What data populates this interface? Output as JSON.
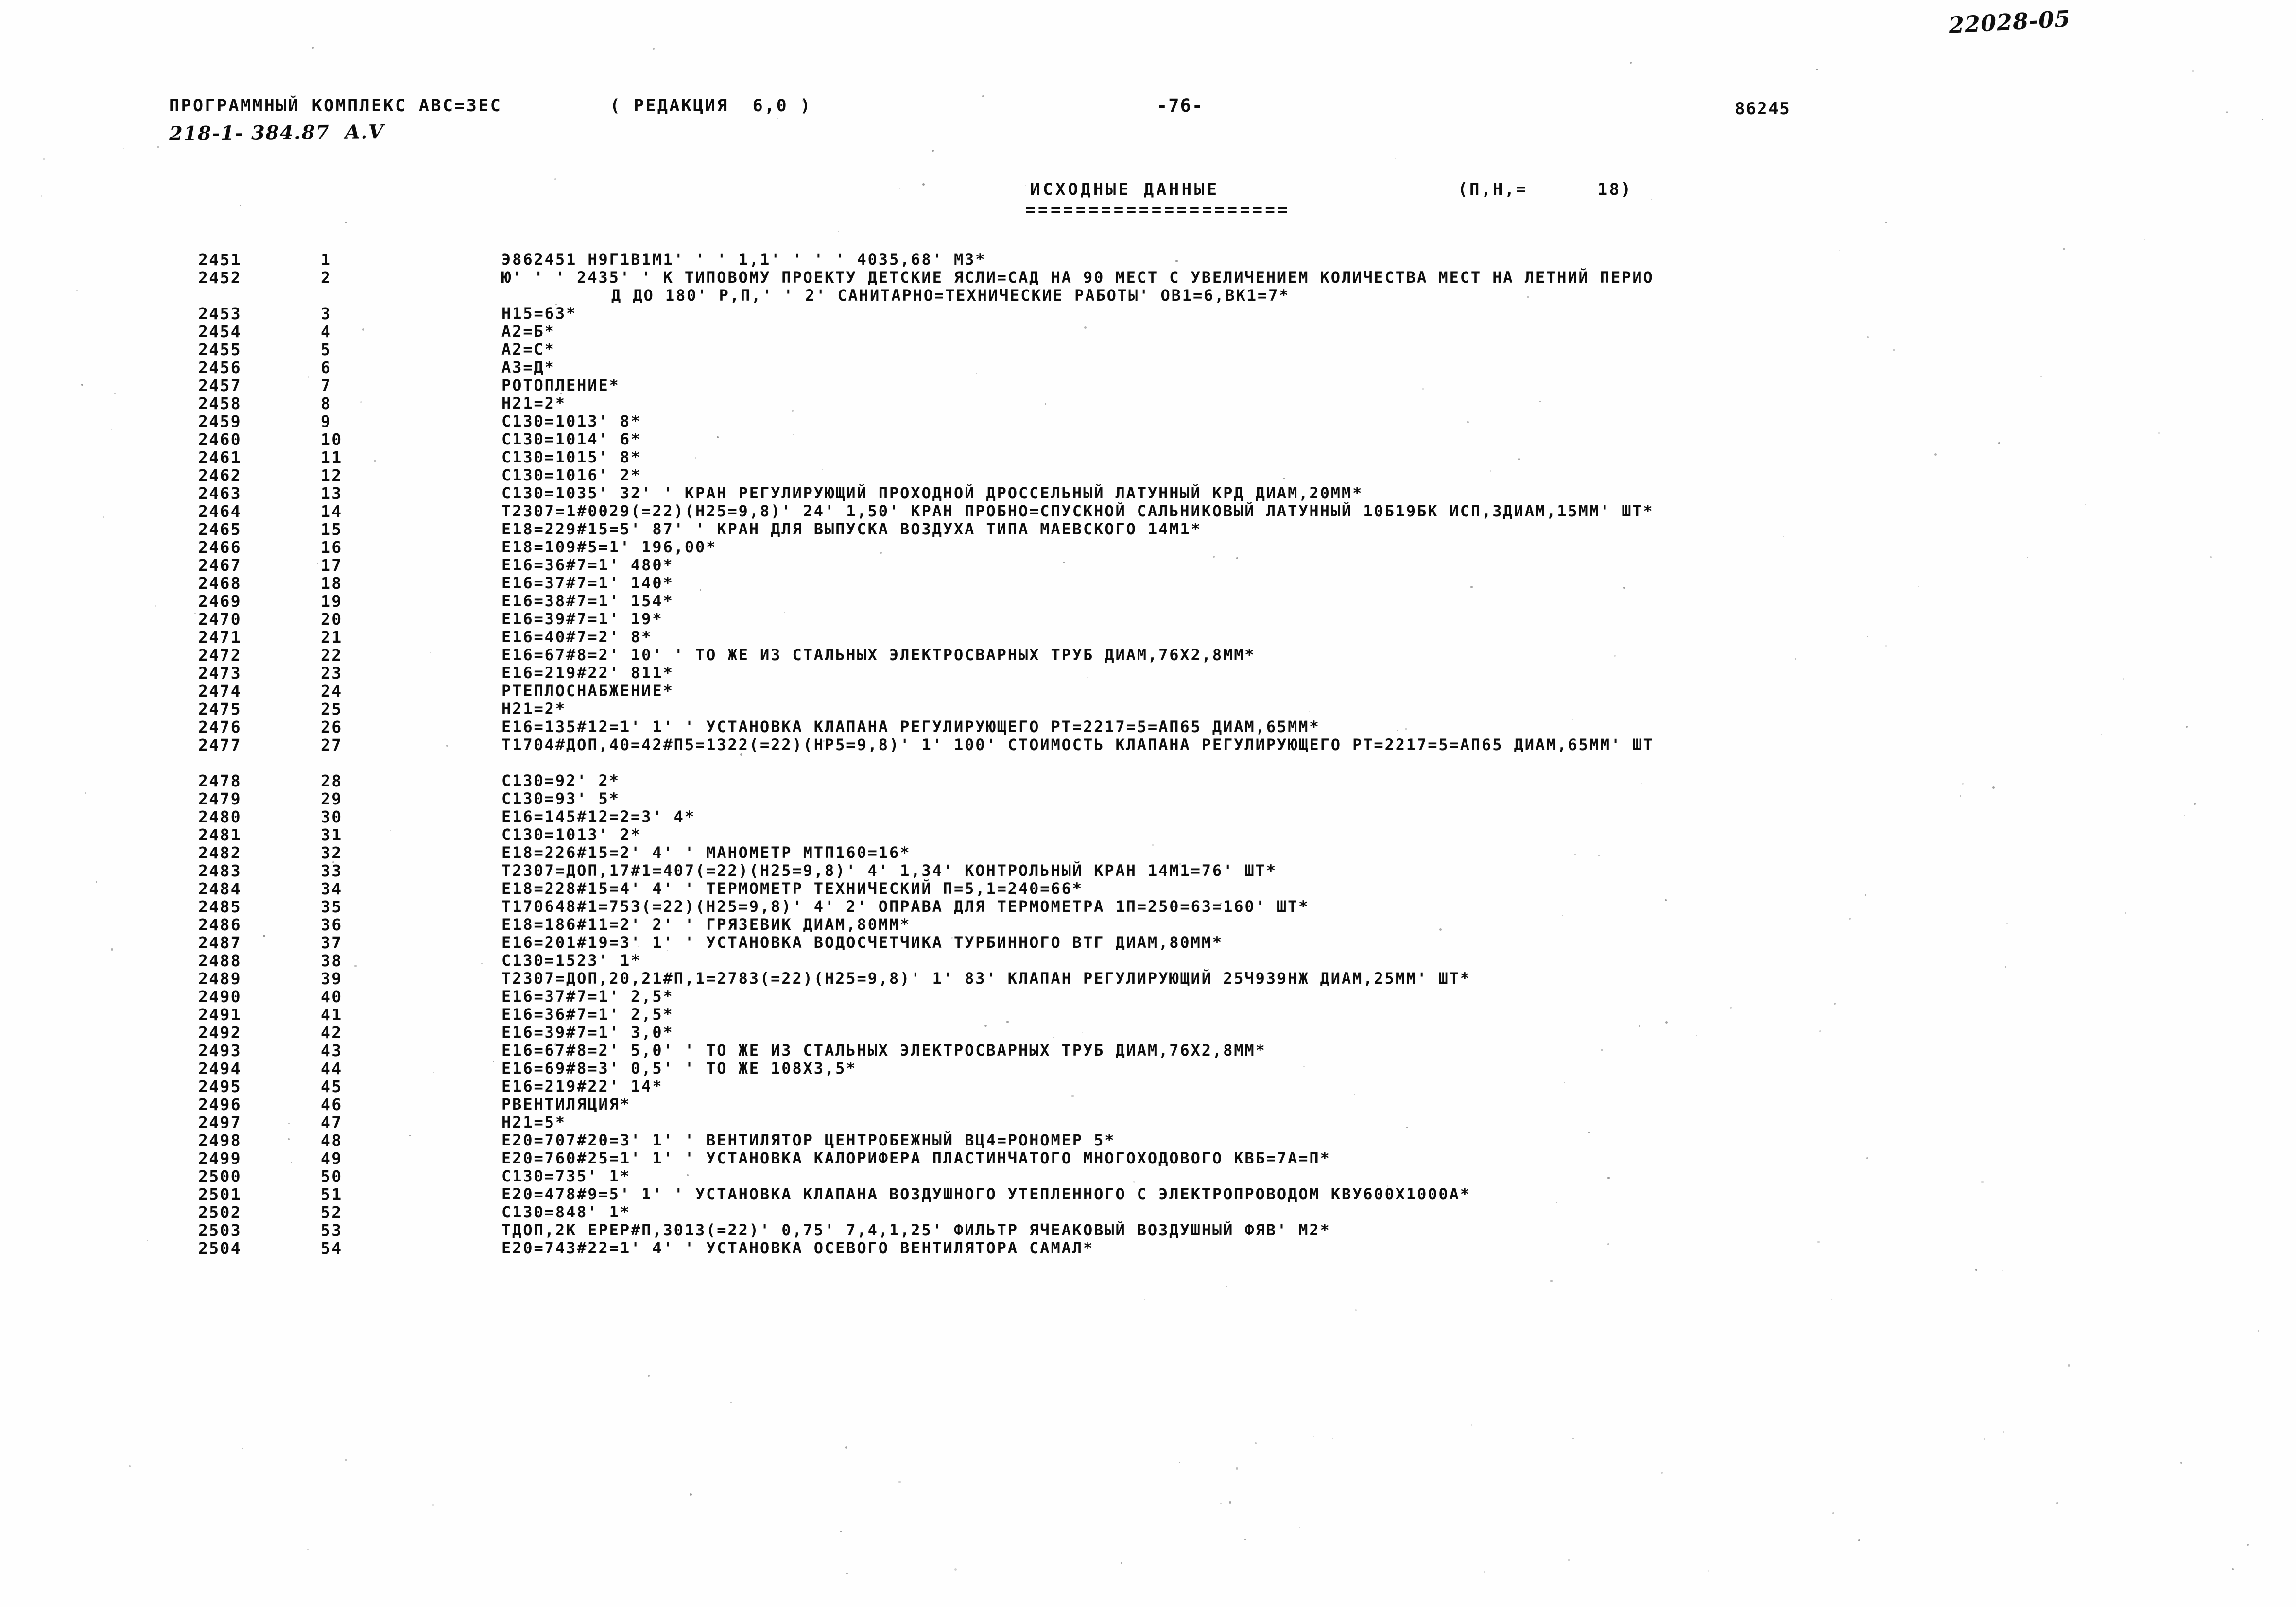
{
  "annotation": {
    "handwritten_top_right": "22028-05"
  },
  "header": {
    "program_title": "ПРОГРАММНЫЙ КОМПЛЕКС АВС=3ЕС    ( РЕДАКЦИЯ  6,0 )",
    "program_name": "ПРОГРАММНЫЙ КОМПЛЕКС АВС=3ЕС",
    "revision": "( РЕДАКЦИЯ  6,0 )",
    "object_code": "218-1- 384.87  A.V",
    "page_number": "-76-",
    "doc_number": "86245"
  },
  "section": {
    "title": "ИСХОДНЫЕ ДАННЫЕ",
    "underline": "=====================",
    "counter": "(П,Н,=      18)"
  },
  "listing": {
    "columns": [
      "line_no",
      "seq_no",
      "record"
    ],
    "rows": [
      {
        "line_no": "2451",
        "seq_no": "1",
        "record": "Э862451 Н9Г1В1М1' ' ' 1,1' ' ' ' 4035,68' М3*"
      },
      {
        "line_no": "2452",
        "seq_no": "2",
        "record": "Ю' ' ' 2435' ' К ТИПОВОМУ ПРОЕКТУ ДЕТСКИЕ ЯСЛИ=САД НА 90 МЕСТ С УВЕЛИЧЕНИЕМ КОЛИЧЕСТВА МЕСТ НА ЛЕТНИЙ ПЕРИО"
      },
      {
        "line_no": "",
        "seq_no": "",
        "record": "Д ДО 180' Р,П,' ' 2' САНИТАРНО=ТЕХНИЧЕСКИЕ РАБОТЫ' ОВ1=6,ВК1=7*",
        "continuation": true
      },
      {
        "line_no": "2453",
        "seq_no": "3",
        "record": "Н15=63*"
      },
      {
        "line_no": "2454",
        "seq_no": "4",
        "record": "А2=Б*"
      },
      {
        "line_no": "2455",
        "seq_no": "5",
        "record": "А2=С*"
      },
      {
        "line_no": "2456",
        "seq_no": "6",
        "record": "А3=Д*"
      },
      {
        "line_no": "2457",
        "seq_no": "7",
        "record": "РОТОПЛЕНИЕ*"
      },
      {
        "line_no": "2458",
        "seq_no": "8",
        "record": "Н21=2*"
      },
      {
        "line_no": "2459",
        "seq_no": "9",
        "record": "С130=1013' 8*"
      },
      {
        "line_no": "2460",
        "seq_no": "10",
        "record": "С130=1014' 6*"
      },
      {
        "line_no": "2461",
        "seq_no": "11",
        "record": "С130=1015' 8*"
      },
      {
        "line_no": "2462",
        "seq_no": "12",
        "record": "С130=1016' 2*"
      },
      {
        "line_no": "2463",
        "seq_no": "13",
        "record": "С130=1035' 32' ' КРАН РЕГУЛИРУЮЩИЙ ПРОХОДНОЙ ДРОССЕЛЬНЫЙ ЛАТУННЫЙ КРД ДИАМ,20ММ*"
      },
      {
        "line_no": "2464",
        "seq_no": "14",
        "record": "Т2307=1#0029(=22)(Н25=9,8)' 24' 1,50' КРАН ПРОБНО=СПУСКНОЙ САЛЬНИКОВЫЙ ЛАТУННЫЙ 10Б19БК ИСП,3ДИАМ,15ММ' ШТ*"
      },
      {
        "line_no": "2465",
        "seq_no": "15",
        "record": "Е18=229#15=5' 87' ' КРАН ДЛЯ ВЫПУСКА ВОЗДУХА ТИПА МАЕВСКОГО 14М1*"
      },
      {
        "line_no": "2466",
        "seq_no": "16",
        "record": "Е18=109#5=1' 196,00*"
      },
      {
        "line_no": "2467",
        "seq_no": "17",
        "record": "Е16=36#7=1' 480*"
      },
      {
        "line_no": "2468",
        "seq_no": "18",
        "record": "Е16=37#7=1' 140*"
      },
      {
        "line_no": "2469",
        "seq_no": "19",
        "record": "Е16=38#7=1' 154*"
      },
      {
        "line_no": "2470",
        "seq_no": "20",
        "record": "Е16=39#7=1' 19*"
      },
      {
        "line_no": "2471",
        "seq_no": "21",
        "record": "Е16=40#7=2' 8*"
      },
      {
        "line_no": "2472",
        "seq_no": "22",
        "record": "Е16=67#8=2' 10' ' ТО ЖЕ ИЗ СТАЛЬНЫХ ЭЛЕКТРОСВАРНЫХ ТРУБ ДИАМ,76Х2,8ММ*"
      },
      {
        "line_no": "2473",
        "seq_no": "23",
        "record": "Е16=219#22' 811*"
      },
      {
        "line_no": "2474",
        "seq_no": "24",
        "record": "РТЕПЛОСНАБЖЕНИЕ*"
      },
      {
        "line_no": "2475",
        "seq_no": "25",
        "record": "Н21=2*"
      },
      {
        "line_no": "2476",
        "seq_no": "26",
        "record": "Е16=135#12=1' 1' ' УСТАНОВКА КЛАПАНА РЕГУЛИРУЮЩЕГО РТ=2217=5=АП65 ДИАМ,65ММ*"
      },
      {
        "line_no": "2477",
        "seq_no": "27",
        "record": "Т1704#ДОП,40=42#П5=1322(=22)(НР5=9,8)' 1' 100' СТОИМОСТЬ КЛАПАНА РЕГУЛИРУЮЩЕГО РТ=2217=5=АП65 ДИАМ,65ММ' ШТ"
      },
      {
        "line_no": "",
        "seq_no": "",
        "record": "",
        "spacer": true
      },
      {
        "line_no": "2478",
        "seq_no": "28",
        "record": "С130=92' 2*"
      },
      {
        "line_no": "2479",
        "seq_no": "29",
        "record": "С130=93' 5*"
      },
      {
        "line_no": "2480",
        "seq_no": "30",
        "record": "Е16=145#12=2=3' 4*"
      },
      {
        "line_no": "2481",
        "seq_no": "31",
        "record": "С130=1013' 2*"
      },
      {
        "line_no": "2482",
        "seq_no": "32",
        "record": "Е18=226#15=2' 4' ' МАНОМЕТР МТП160=16*"
      },
      {
        "line_no": "2483",
        "seq_no": "33",
        "record": "Т2307=ДОП,17#1=407(=22)(Н25=9,8)' 4' 1,34' КОНТРОЛЬНЫЙ КРАН 14М1=76' ШТ*"
      },
      {
        "line_no": "2484",
        "seq_no": "34",
        "record": "Е18=228#15=4' 4' ' ТЕРМОМЕТР ТЕХНИЧЕСКИЙ П=5,1=240=66*"
      },
      {
        "line_no": "2485",
        "seq_no": "35",
        "record": "Т170648#1=753(=22)(Н25=9,8)' 4' 2' ОПРАВА ДЛЯ ТЕРМОМЕТРА 1П=250=63=160' ШТ*"
      },
      {
        "line_no": "2486",
        "seq_no": "36",
        "record": "Е18=186#11=2' 2' ' ГРЯЗЕВИК ДИАМ,80ММ*"
      },
      {
        "line_no": "2487",
        "seq_no": "37",
        "record": "Е16=201#19=3' 1' ' УСТАНОВКА ВОДОСЧЕТЧИКА ТУРБИННОГО ВТГ ДИАМ,80ММ*"
      },
      {
        "line_no": "2488",
        "seq_no": "38",
        "record": "С130=1523' 1*"
      },
      {
        "line_no": "2489",
        "seq_no": "39",
        "record": "Т2307=ДОП,20,21#П,1=2783(=22)(Н25=9,8)' 1' 83' КЛАПАН РЕГУЛИРУЮЩИЙ 25Ч939НЖ ДИАМ,25ММ' ШТ*"
      },
      {
        "line_no": "2490",
        "seq_no": "40",
        "record": "Е16=37#7=1' 2,5*"
      },
      {
        "line_no": "2491",
        "seq_no": "41",
        "record": "Е16=36#7=1' 2,5*"
      },
      {
        "line_no": "2492",
        "seq_no": "42",
        "record": "Е16=39#7=1' 3,0*"
      },
      {
        "line_no": "2493",
        "seq_no": "43",
        "record": "Е16=67#8=2' 5,0' ' ТО ЖЕ ИЗ СТАЛЬНЫХ ЭЛЕКТРОСВАРНЫХ ТРУБ ДИАМ,76Х2,8ММ*"
      },
      {
        "line_no": "2494",
        "seq_no": "44",
        "record": "Е16=69#8=3' 0,5' ' ТО ЖЕ 108Х3,5*"
      },
      {
        "line_no": "2495",
        "seq_no": "45",
        "record": "Е16=219#22' 14*"
      },
      {
        "line_no": "2496",
        "seq_no": "46",
        "record": "РВЕНТИЛЯЦИЯ*"
      },
      {
        "line_no": "2497",
        "seq_no": "47",
        "record": "Н21=5*"
      },
      {
        "line_no": "2498",
        "seq_no": "48",
        "record": "Е20=707#20=3' 1' ' ВЕНТИЛЯТОР ЦЕНТРОБЕЖНЫЙ ВЦ4=РОНОМЕР 5*"
      },
      {
        "line_no": "2499",
        "seq_no": "49",
        "record": "Е20=760#25=1' 1' ' УСТАНОВКА КАЛОРИФЕРА ПЛАСТИНЧАТОГО МНОГОХОДОВОГО КВБ=7А=П*"
      },
      {
        "line_no": "2500",
        "seq_no": "50",
        "record": "С130=735' 1*"
      },
      {
        "line_no": "2501",
        "seq_no": "51",
        "record": "Е20=478#9=5' 1' ' УСТАНОВКА КЛАПАНА ВОЗДУШНОГО УТЕПЛЕННОГО С ЭЛЕКТРОПРОВОДОМ КВУ600Х1000А*"
      },
      {
        "line_no": "2502",
        "seq_no": "52",
        "record": "С130=848' 1*"
      },
      {
        "line_no": "2503",
        "seq_no": "53",
        "record": "ТДОП,2К ЕРЕР#П,3013(=22)' 0,75' 7,4,1,25' ФИЛЬТР ЯЧЕАКОВЫЙ ВОЗДУШНЫЙ ФЯВ' М2*"
      },
      {
        "line_no": "2504",
        "seq_no": "54",
        "record": "Е20=743#22=1' 4' ' УСТАНОВКА ОСЕВОГО ВЕНТИЛЯТОРА САМАЛ*"
      }
    ]
  }
}
